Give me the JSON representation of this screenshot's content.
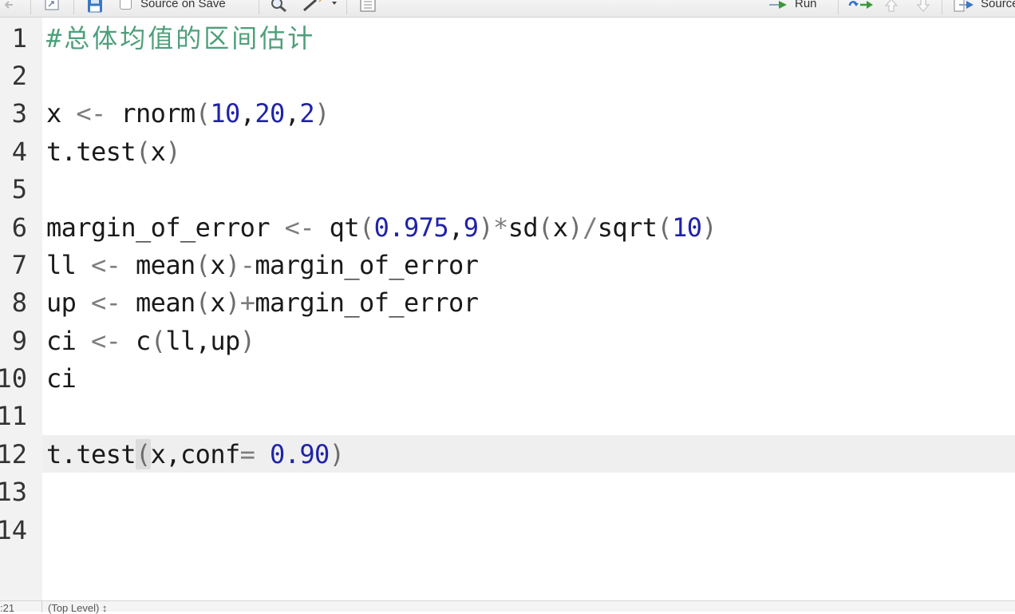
{
  "toolbar": {
    "source_on_save_label": "Source on Save",
    "source_on_save_checked": false,
    "run_label": "Run",
    "source_label": "Source",
    "icons": [
      "back-arrow-icon",
      "show-in-window-icon",
      "save-icon",
      "search-icon",
      "code-tools-wand-icon",
      "compile-report-icon",
      "run-icon",
      "rerun-icon",
      "go-up-icon",
      "go-down-icon",
      "source-icon"
    ],
    "colors": {
      "run_arrow": "#3a9a3a",
      "rerun_arrow_blue": "#2f6fd1"
    }
  },
  "editor": {
    "active_line": 12,
    "colors": {
      "comment": "#4d9f7a",
      "number": "#1f23a8",
      "operator": "#7d7d7d",
      "default": "#1a1a1a",
      "gutter": "#f2f2f2",
      "active_line": "#efefef"
    },
    "lines": [
      {
        "number": "1",
        "code": "#总体均值的区间估计"
      },
      {
        "number": "2",
        "code": ""
      },
      {
        "number": "3",
        "code": "x <- rnorm(10,20,2)"
      },
      {
        "number": "4",
        "code": "t.test(x)"
      },
      {
        "number": "5",
        "code": ""
      },
      {
        "number": "6",
        "code": "margin_of_error <- qt(0.975,9)*sd(x)/sqrt(10)"
      },
      {
        "number": "7",
        "code": "ll <- mean(x)-margin_of_error"
      },
      {
        "number": "8",
        "code": "up <- mean(x)+margin_of_error"
      },
      {
        "number": "9",
        "code": "ci <- c(ll,up)"
      },
      {
        "number": "10",
        "code": "ci"
      },
      {
        "number": "11",
        "code": ""
      },
      {
        "number": "12",
        "code": "t.test(x,conf= 0.90)"
      },
      {
        "number": "13",
        "code": ""
      },
      {
        "number": "14",
        "code": ""
      }
    ]
  },
  "statusbar": {
    "position": ":21",
    "scope": "(Top Level) ↕"
  }
}
